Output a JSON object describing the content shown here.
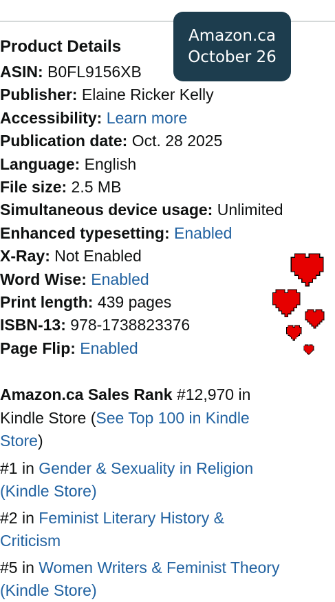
{
  "badge": {
    "line1": "Amazon.ca",
    "line2": "October 26"
  },
  "product_details": {
    "title": "Product Details",
    "rows": [
      {
        "label": "ASIN:",
        "value": "B0FL9156XB",
        "is_link": false
      },
      {
        "label": "Publisher:",
        "value": "Elaine Ricker Kelly",
        "is_link": false
      },
      {
        "label": "Accessibility:",
        "value": "Learn more",
        "is_link": true
      },
      {
        "label": "Publication date:",
        "value": "Oct. 28 2025",
        "is_link": false
      },
      {
        "label": "Language:",
        "value": "English",
        "is_link": false
      },
      {
        "label": "File size:",
        "value": "2.5 MB",
        "is_link": false
      },
      {
        "label": "Simultaneous device usage:",
        "value": "Unlimited",
        "is_link": false
      },
      {
        "label": "Enhanced typesetting:",
        "value": "Enabled",
        "is_link": true
      },
      {
        "label": "X-Ray:",
        "value": "Not Enabled",
        "is_link": false
      },
      {
        "label": "Word Wise:",
        "value": "Enabled",
        "is_link": true
      },
      {
        "label": "Print length:",
        "value": "439 pages",
        "is_link": false
      },
      {
        "label": "ISBN-13:",
        "value": "978-1738823376",
        "is_link": false
      },
      {
        "label": "Page Flip:",
        "value": "Enabled",
        "is_link": true
      }
    ]
  },
  "sales_rank": {
    "label": "Amazon.ca Sales Rank",
    "value": "#12,970 in",
    "store": "Kindle Store (",
    "top100_link": "See Top 100 in Kindle",
    "top100_link_cont": "Store",
    "close": ")",
    "categories": [
      {
        "rank": "#1 in",
        "link_line1": "Gender & Sexuality in Religion",
        "link_line2": "(Kindle Store)"
      },
      {
        "rank": "#2 in",
        "link_line1": "Feminist Literary History &",
        "link_line2": "Criticism"
      },
      {
        "rank": "#5 in",
        "link_line1": "Women Writers & Feminist Theory",
        "link_line2": "(Kindle Store)"
      }
    ]
  },
  "colors": {
    "badge_bg": "#1d3d4e",
    "link": "#2162a1",
    "heart": "#e60000"
  },
  "decor": {
    "icon": "pixel-heart-icon",
    "count": 5
  }
}
